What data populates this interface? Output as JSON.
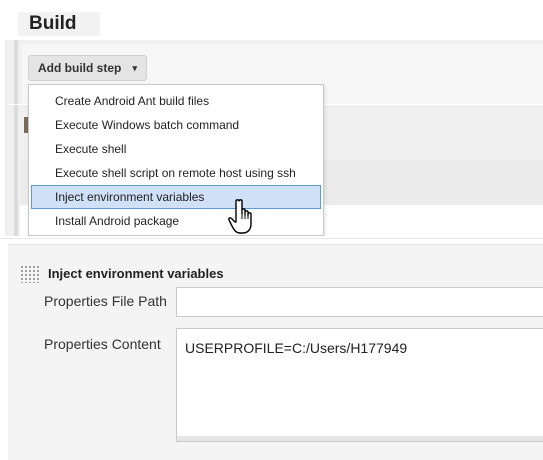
{
  "top": {
    "heading": "Build",
    "add_step_button": {
      "label": "Add build step",
      "caret": "▾"
    },
    "menu_items": [
      "Create Android Ant build files",
      "Execute Windows batch command",
      "Execute shell",
      "Execute shell script on remote host using ssh",
      "Inject environment variables",
      "Install Android package"
    ],
    "highlighted_item": "Inject environment variables"
  },
  "inject_block": {
    "title": "Inject environment variables",
    "properties_file_path": {
      "label": "Properties File Path",
      "value": ""
    },
    "properties_content": {
      "label": "Properties Content",
      "value": "USERPROFILE=C:/Users/H177949"
    }
  },
  "colors": {
    "highlight_bg": "#cfe0f7",
    "highlight_border": "#5b9bd5",
    "panel_bg": "#f4f4f4"
  },
  "icons": {
    "cursor": "hand-pointer-icon",
    "drag": "drag-handle-icon"
  }
}
